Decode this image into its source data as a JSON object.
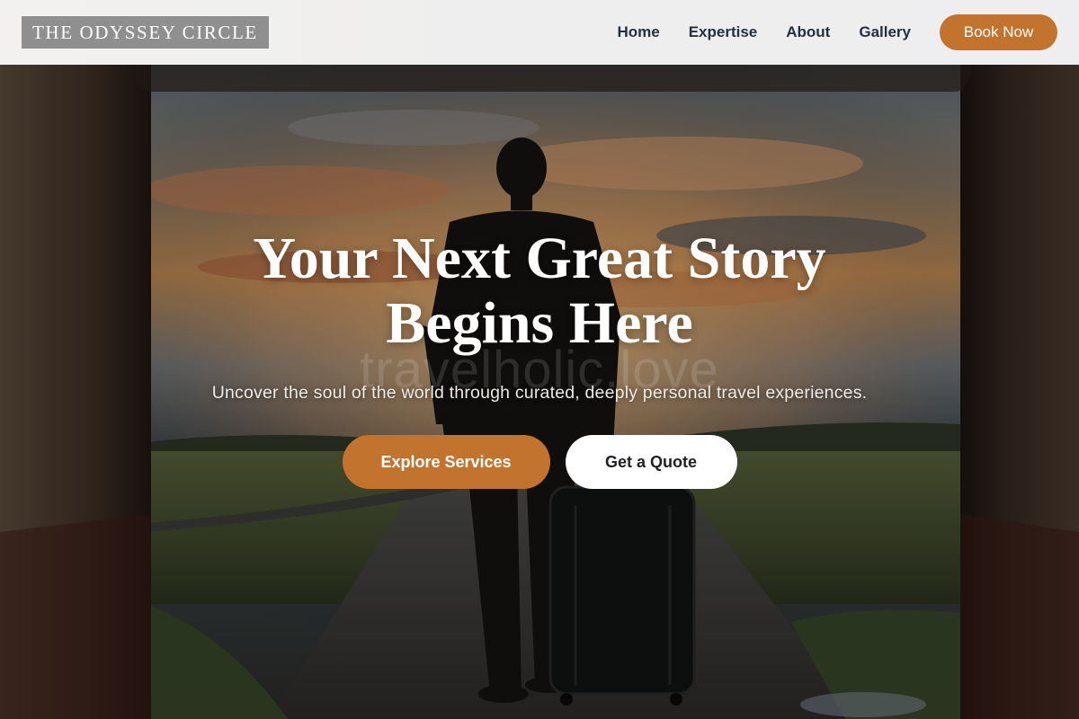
{
  "header": {
    "logo_text": "THE ODYSSEY CIRCLE",
    "nav": [
      {
        "label": "Home"
      },
      {
        "label": "Expertise"
      },
      {
        "label": "About"
      },
      {
        "label": "Gallery"
      }
    ],
    "cta_label": "Book Now"
  },
  "hero": {
    "headline_line1": "Your Next Great Story",
    "headline_line2": "Begins Here",
    "watermark": "travelholic.love",
    "subtitle": "Uncover the soul of the world through curated, deeply personal travel experiences.",
    "primary_button": "Explore Services",
    "secondary_button": "Get a Quote",
    "background_image": "traveler-with-suitcase-under-archway-at-sunset"
  },
  "colors": {
    "accent": "#c2732d",
    "nav_text": "#22303f",
    "logo_bg": "#8f8f8f"
  }
}
